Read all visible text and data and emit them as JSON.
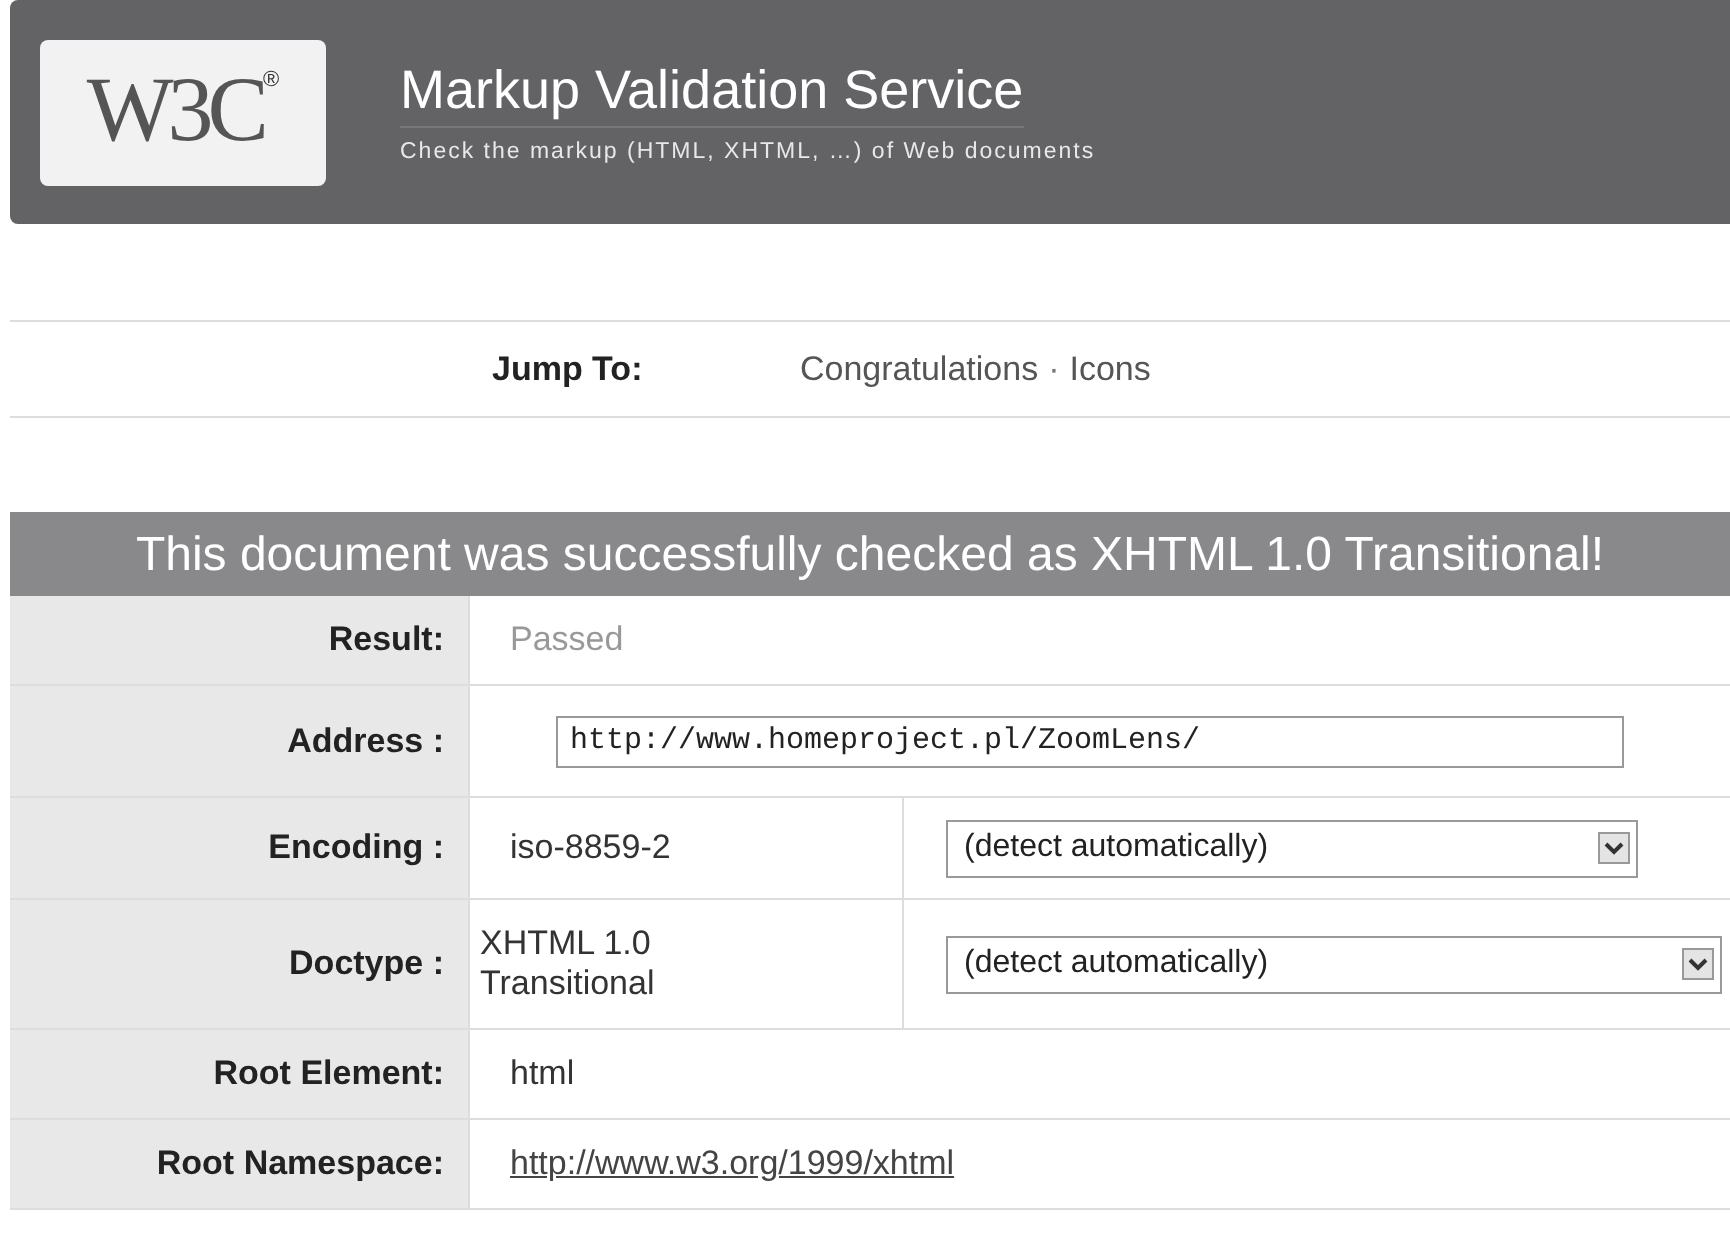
{
  "header": {
    "logo": {
      "text": "W3C",
      "mark": "®"
    },
    "title": "Markup Validation Service",
    "subtitle": "Check the markup (HTML, XHTML, …) of Web documents"
  },
  "jump_to": {
    "label": "Jump To:",
    "links": [
      {
        "text": "Congratulations"
      },
      {
        "text": "Icons"
      }
    ],
    "separator": "·"
  },
  "result": {
    "heading": "This document was successfully checked as XHTML 1.0 Transitional!",
    "rows": [
      {
        "kind": "text",
        "label": "Result:",
        "value": "Passed",
        "muted": true
      },
      {
        "kind": "input",
        "label": "Address :",
        "value": "http://www.homeproject.pl/ZoomLens/"
      },
      {
        "kind": "select",
        "label": "Encoding :",
        "value": "iso-8859-2",
        "option": "(detect automatically)"
      },
      {
        "kind": "select",
        "label": "Doctype :",
        "value": "XHTML 1.0 Transitional",
        "option": "(detect automatically)"
      },
      {
        "kind": "text",
        "label": "Root Element:",
        "value": "html",
        "muted": false
      },
      {
        "kind": "link",
        "label": "Root Namespace:",
        "value": "http://www.w3.org/1999/xhtml"
      }
    ]
  }
}
